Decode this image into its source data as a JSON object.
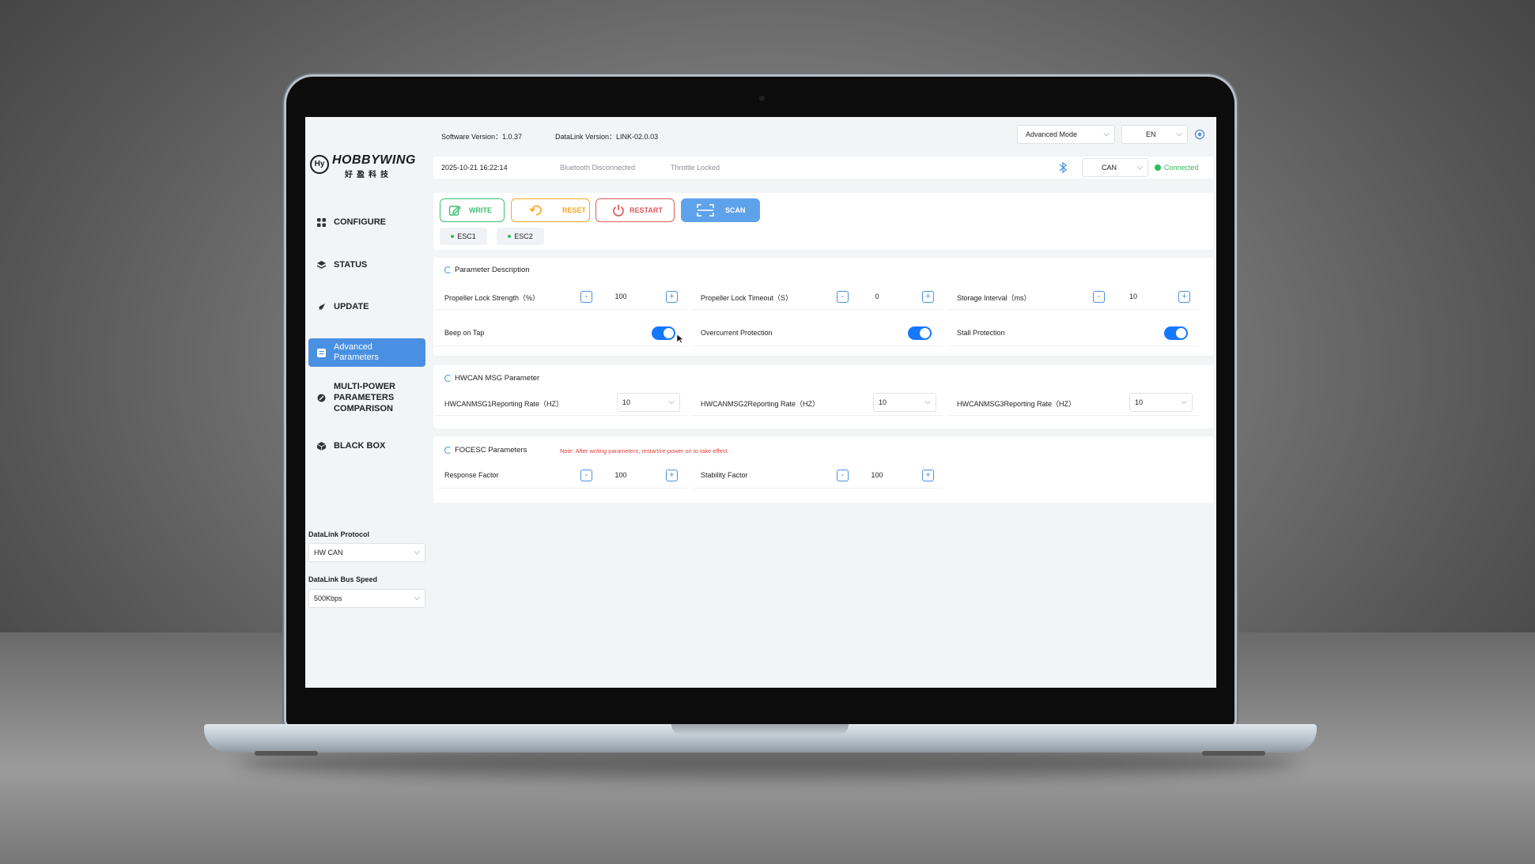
{
  "window": {
    "colors": {
      "close": "#ff5f57",
      "minimize": "#febc2e",
      "maximize": "#28c840",
      "accent": "#4a90e2",
      "connected": "#2fbf5a"
    }
  },
  "brand": {
    "name": "HOBBYWING",
    "sub": "好盈科技",
    "mark": "Hy"
  },
  "header": {
    "software_version": "Software Version：1.0.37",
    "datalink_version": "DataLink Version：LINK-02.0.03",
    "mode": "Advanced Mode",
    "language": "EN"
  },
  "status": {
    "datetime": "2025-10-21 16:22:14",
    "bluetooth": "Bluetooth Disconnected",
    "throttle": "Throttle Locked",
    "bus": "CAN",
    "connection": "Connected"
  },
  "sidebar": {
    "items": [
      {
        "label": "CONFIGURE",
        "icon": "grid-icon"
      },
      {
        "label": "STATUS",
        "icon": "layers-icon"
      },
      {
        "label": "UPDATE",
        "icon": "rocket-icon"
      },
      {
        "label": "Advanced Parameters",
        "line1": "Advanced",
        "line2": "Parameters",
        "icon": "list-icon",
        "active": true
      },
      {
        "label": "MULTI-POWER PARAMETERS COMPARISON",
        "line1": "MULTI-POWER",
        "line2": "PARAMETERS",
        "line3": "COMPARISON",
        "icon": "compare-icon"
      },
      {
        "label": "BLACK BOX",
        "icon": "cube-icon"
      }
    ],
    "protocol_label": "DataLink Protocol",
    "protocol_value": "HW CAN",
    "bus_speed_label": "DataLink Bus Speed",
    "bus_speed_value": "500Kbps"
  },
  "toolbar": {
    "write": "WRITE",
    "reset": "RESET",
    "restart": "RESTART",
    "scan": "SCAN",
    "esc_tabs": [
      "ESC1",
      "ESC2"
    ]
  },
  "parameter_section": {
    "title": "Parameter Description",
    "lock_strength": {
      "label": "Propeller Lock Strength（%）",
      "value": "100"
    },
    "lock_timeout": {
      "label": "Propeller Lock Timeout（S）",
      "value": "0"
    },
    "storage_interval": {
      "label": "Storage Interval（ms）",
      "value": "10"
    },
    "beep_on_tap": {
      "label": "Beep on Tap",
      "on": true
    },
    "overcurrent": {
      "label": "Overcurrent Protection",
      "on": true
    },
    "stall": {
      "label": "Stall Protection",
      "on": true
    }
  },
  "hwcan_section": {
    "title": "HWCAN MSG Parameter",
    "rates": [
      {
        "label": "HWCANMSG1Reporting Rate（HZ）",
        "value": "10"
      },
      {
        "label": "HWCANMSG2Reporting Rate（HZ）",
        "value": "10"
      },
      {
        "label": "HWCANMSG3Reporting Rate（HZ）",
        "value": "10"
      }
    ]
  },
  "focesc_section": {
    "title": "FOCESC Parameters",
    "note": "Note: After writing parameters, restart/re-power on to take effect.",
    "response": {
      "label": "Response Factor",
      "value": "100"
    },
    "stability": {
      "label": "Stability Factor",
      "value": "100"
    }
  },
  "controls": {
    "minus": "-",
    "plus": "+",
    "chevron": "⌵"
  }
}
